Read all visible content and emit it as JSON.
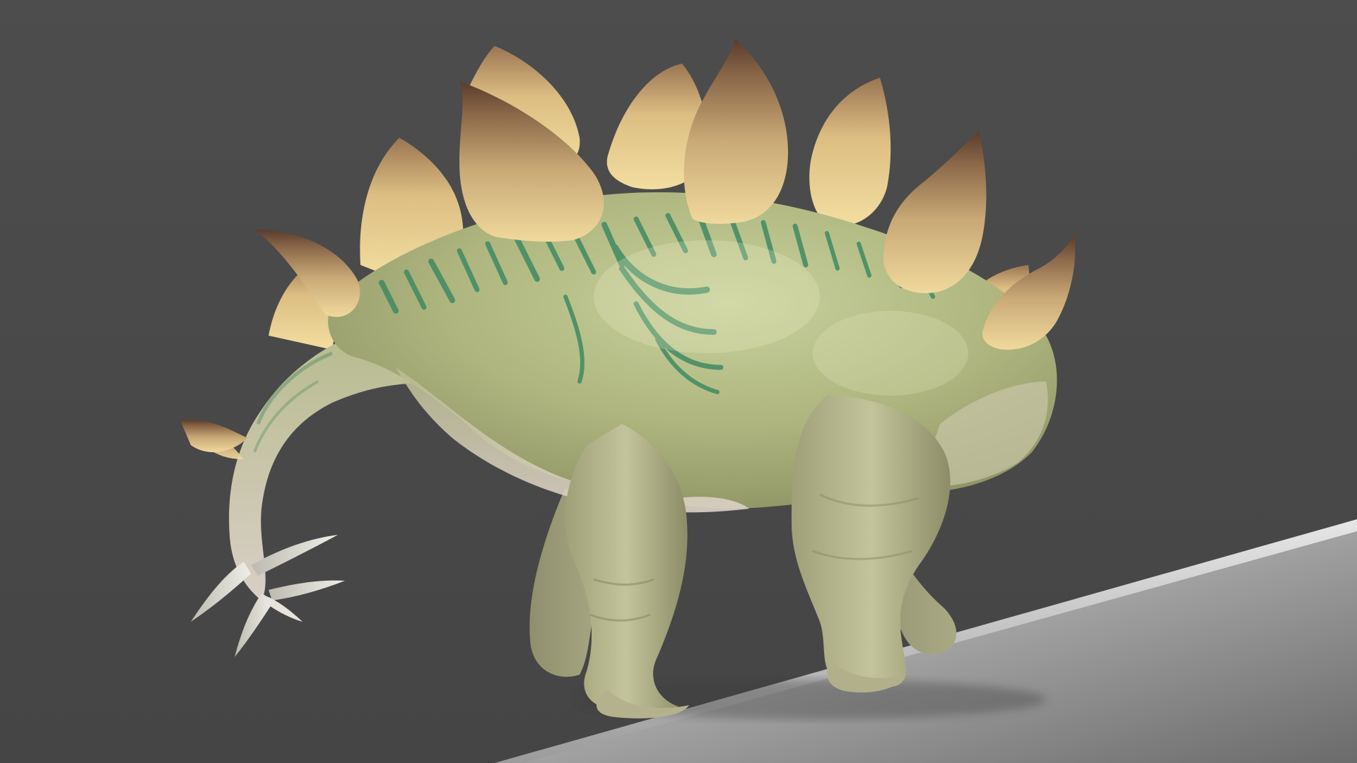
{
  "scene": {
    "subject": "stegosaurus-3d-render",
    "colors": {
      "background": "#4a4a4a",
      "floor_light": "#cfcfcf",
      "floor_dark": "#6e6e6e",
      "skin_light": "#c9cf9f",
      "skin_mid": "#a9b07b",
      "skin_belly": "#dcd2c6",
      "stripe": "#3f8a63",
      "plate_base": "#e7cc8c",
      "plate_tip": "#6b4a36",
      "spike": "#d8d6cc"
    }
  }
}
